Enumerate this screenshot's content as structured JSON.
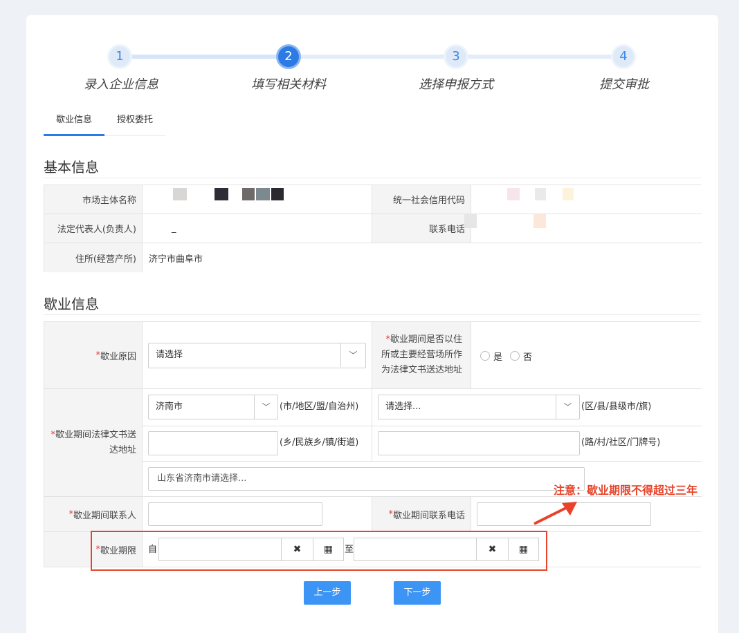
{
  "steps": [
    {
      "num": "1",
      "label": "录入企业信息"
    },
    {
      "num": "2",
      "label": "填写相关材料"
    },
    {
      "num": "3",
      "label": "选择申报方式"
    },
    {
      "num": "4",
      "label": "提交审批"
    }
  ],
  "tabs": [
    "歇业信息",
    "授权委托"
  ],
  "basic": {
    "title": "基本信息",
    "market_name_label": "市场主体名称",
    "credit_code_label": "统一社会信用代码",
    "legal_rep_label": "法定代表人(负责人)",
    "legal_rep_value": "_",
    "phone_label": "联系电话",
    "address_label": "住所(经营产所)",
    "address_value": "济宁市曲阜市"
  },
  "suspend": {
    "title": "歇业信息",
    "required_mark": "*",
    "reason_label": "歇业原因",
    "reason_value": "请选择",
    "use_address_label": "歇业期间是否以住所或主要经营场所作为法律文书送达地址",
    "yes": "是",
    "no": "否",
    "service_address_label": "歇业期间法律文书送达地址",
    "city_value": "济南市",
    "city_hint": "(市/地区/盟/自治州)",
    "district_value": "请选择...",
    "district_hint": "(区/县/县级市/旗)",
    "town_hint": "(乡/民族乡/镇/街道)",
    "road_hint": "(路/村/社区/门牌号)",
    "full_address": "山东省济南市请选择...",
    "contact_label": "歇业期间联系人",
    "contact_phone_label": "歇业期间联系电话",
    "period_label": "歇业期限",
    "from": "自",
    "to": "至",
    "clear_icon": "✖",
    "calendar_icon": "▦"
  },
  "annotation": {
    "note": "注意：歇业期限不得超过三年"
  },
  "buttons": {
    "prev": "上一步",
    "next": "下一步"
  },
  "colors": {
    "accent": "#2c7be5",
    "button": "#3c95f5",
    "annotation": "#e8432a"
  }
}
